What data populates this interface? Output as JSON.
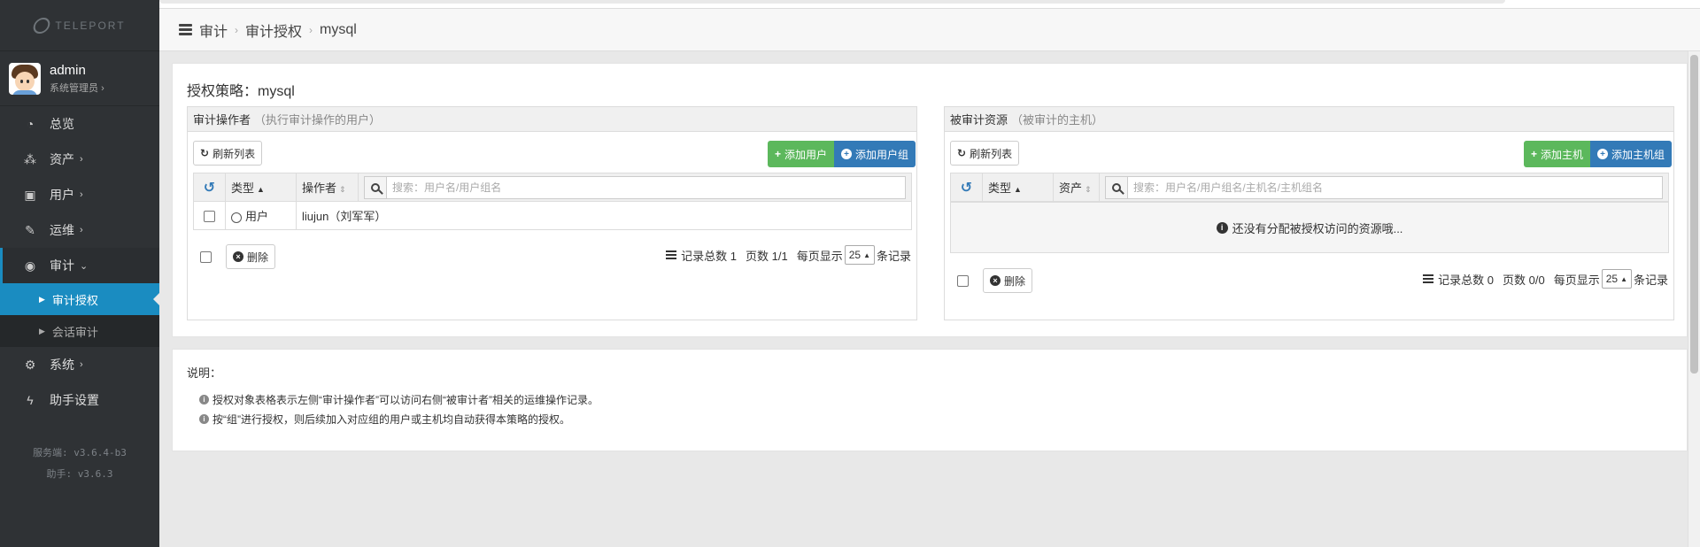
{
  "brand": {
    "name": "TELEPORT"
  },
  "user": {
    "name": "admin",
    "role": "系统管理员"
  },
  "sidebar": {
    "items": [
      {
        "label": "总览",
        "icon": "dashboard-icon"
      },
      {
        "label": "资产",
        "icon": "cubes-icon",
        "arrow": "›"
      },
      {
        "label": "用户",
        "icon": "address-book-icon",
        "arrow": "›"
      },
      {
        "label": "运维",
        "icon": "wrench-icon",
        "arrow": "›"
      },
      {
        "label": "审计",
        "icon": "eye-icon",
        "arrow": "⌄"
      }
    ],
    "sub_items": [
      {
        "label": "审计授权",
        "active": true
      },
      {
        "label": "会话审计",
        "active": false
      }
    ],
    "bottom_items": [
      {
        "label": "系统",
        "icon": "gear-icon",
        "arrow": "›"
      },
      {
        "label": "助手设置",
        "icon": "bolt-icon"
      }
    ],
    "versions": {
      "server": "服务端: v3.6.4-b3",
      "assist": "助手: v3.6.3"
    }
  },
  "breadcrumb": {
    "items": [
      "审计",
      "审计授权",
      "mysql"
    ]
  },
  "policy": {
    "title": "授权策略：mysql"
  },
  "operators": {
    "header": "审计操作者",
    "hint": "（执行审计操作的用户）",
    "refresh_label": "刷新列表",
    "add_user_label": "添加用户",
    "add_group_label": "添加用户组",
    "columns": {
      "type": "类型",
      "name": "操作者"
    },
    "search_placeholder": "搜索：用户名/用户组名",
    "rows": [
      {
        "type": "用户",
        "name": "liujun（刘军军）"
      }
    ],
    "delete_label": "删除",
    "footer": {
      "total": "记录总数 1",
      "pages": "页数 1/1",
      "per_page_prefix": "每页显示",
      "page_size": "25",
      "per_page_suffix": "条记录"
    }
  },
  "resources": {
    "header": "被审计资源",
    "hint": "（被审计的主机）",
    "refresh_label": "刷新列表",
    "add_host_label": "添加主机",
    "add_group_label": "添加主机组",
    "columns": {
      "type": "类型",
      "name": "资产"
    },
    "search_placeholder": "搜索：用户名/用户组名/主机名/主机组名",
    "empty_text": "还没有分配被授权访问的资源哦...",
    "delete_label": "删除",
    "footer": {
      "total": "记录总数 0",
      "pages": "页数 0/0",
      "per_page_prefix": "每页显示",
      "page_size": "25",
      "per_page_suffix": "条记录"
    }
  },
  "notes": {
    "title": "说明：",
    "lines": [
      "授权对象表格表示左侧“审计操作者”可以访问右侧“被审计者”相关的运维操作记录。",
      "按“组”进行授权，则后续加入对应组的用户或主机均自动获得本策略的授权。"
    ]
  },
  "colors": {
    "accent": "#1a8cc1",
    "sidebar_bg": "#2f3235",
    "green": "#5cb85c",
    "blue": "#337ab7"
  }
}
